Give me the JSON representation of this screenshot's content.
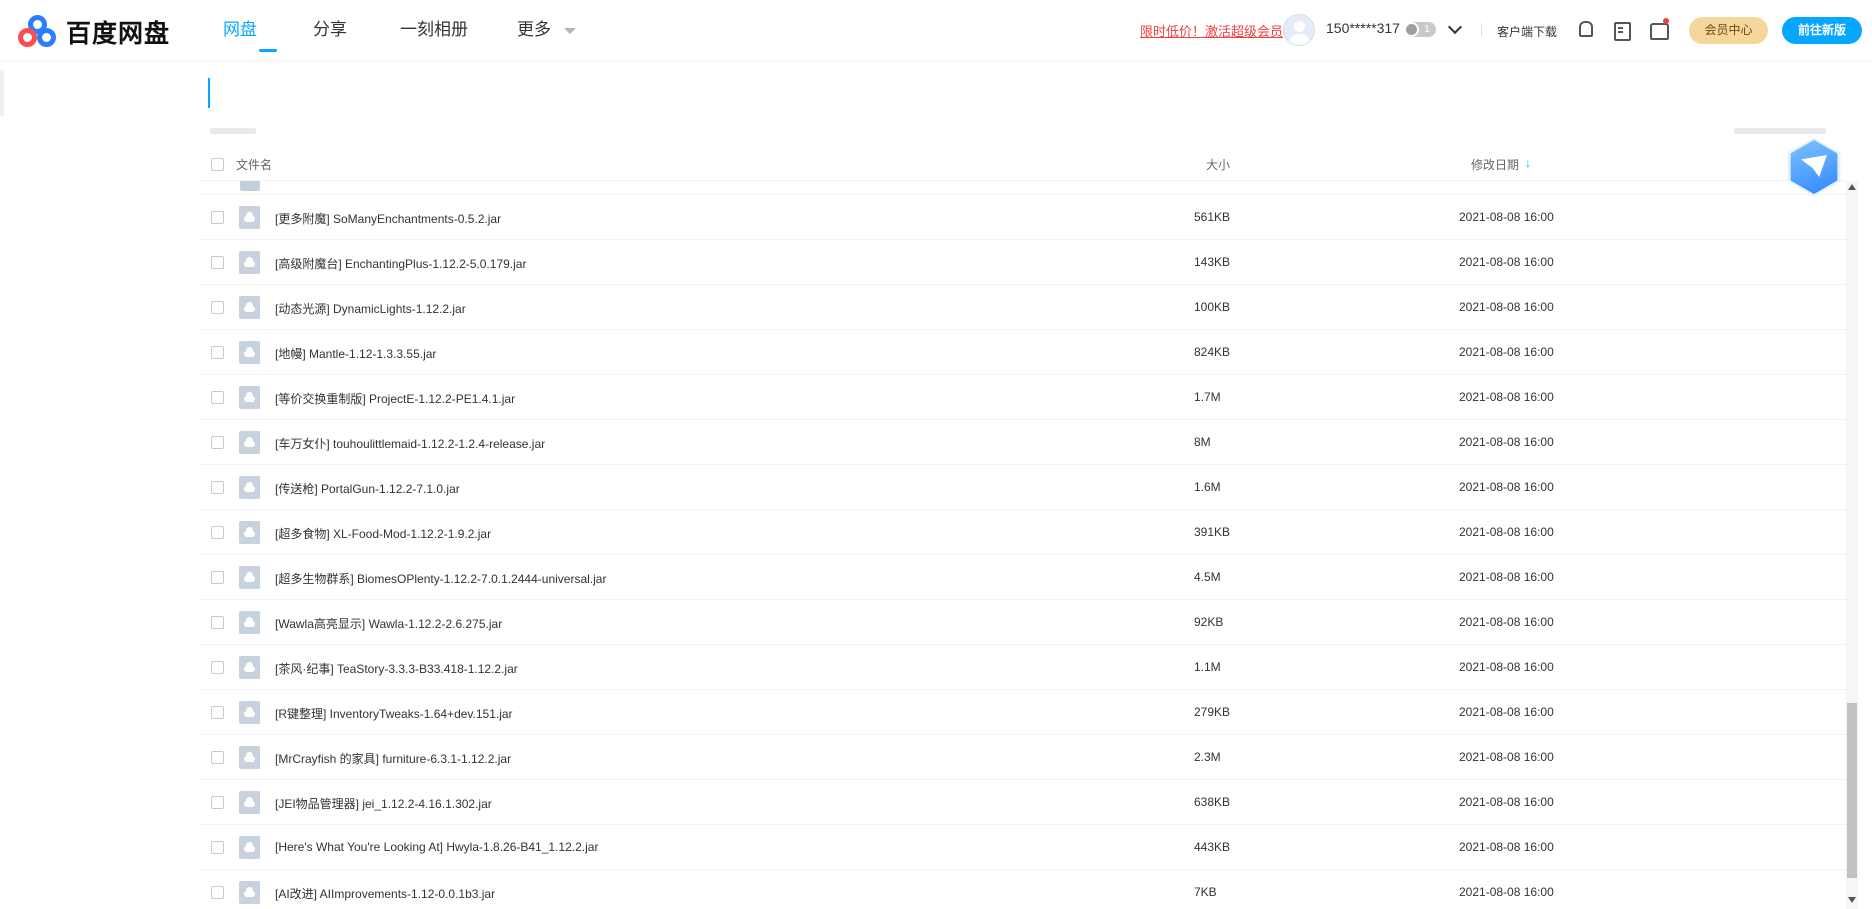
{
  "app": {
    "logo_text": "百度网盘"
  },
  "nav": {
    "items": [
      {
        "label": "网盘",
        "active": true
      },
      {
        "label": "分享",
        "active": false
      },
      {
        "label": "一刻相册",
        "active": false
      },
      {
        "label": "更多",
        "active": false
      }
    ]
  },
  "header": {
    "promo_text": "限时低价！激活超级会员",
    "username": "150*****317",
    "vip_level": "1",
    "client_download": "客户端下载",
    "member_center": "会员中心",
    "new_version": "前往新版",
    "icons": [
      "bell-icon",
      "clipboard-icon",
      "shirt-icon"
    ]
  },
  "file_list": {
    "columns": {
      "name": "文件名",
      "size": "大小",
      "date": "修改日期"
    },
    "sort": {
      "column": "date",
      "direction": "desc"
    },
    "rows": [
      {
        "name": "[更多附魔] SoManyEnchantments-0.5.2.jar",
        "size": "561KB",
        "date": "2021-08-08 16:00"
      },
      {
        "name": "[高级附魔台] EnchantingPlus-1.12.2-5.0.179.jar",
        "size": "143KB",
        "date": "2021-08-08 16:00"
      },
      {
        "name": "[动态光源] DynamicLights-1.12.2.jar",
        "size": "100KB",
        "date": "2021-08-08 16:00"
      },
      {
        "name": "[地幔] Mantle-1.12-1.3.3.55.jar",
        "size": "824KB",
        "date": "2021-08-08 16:00"
      },
      {
        "name": "[等价交换重制版] ProjectE-1.12.2-PE1.4.1.jar",
        "size": "1.7M",
        "date": "2021-08-08 16:00"
      },
      {
        "name": "[车万女仆] touhoulittlemaid-1.12.2-1.2.4-release.jar",
        "size": "8M",
        "date": "2021-08-08 16:00"
      },
      {
        "name": "[传送枪] PortalGun-1.12.2-7.1.0.jar",
        "size": "1.6M",
        "date": "2021-08-08 16:00"
      },
      {
        "name": "[超多食物] XL-Food-Mod-1.12.2-1.9.2.jar",
        "size": "391KB",
        "date": "2021-08-08 16:00"
      },
      {
        "name": "[超多生物群系] BiomesOPlenty-1.12.2-7.0.1.2444-universal.jar",
        "size": "4.5M",
        "date": "2021-08-08 16:00"
      },
      {
        "name": "[Wawla高亮显示] Wawla-1.12.2-2.6.275.jar",
        "size": "92KB",
        "date": "2021-08-08 16:00"
      },
      {
        "name": "[茶风·纪事] TeaStory-3.3.3-B33.418-1.12.2.jar",
        "size": "1.1M",
        "date": "2021-08-08 16:00"
      },
      {
        "name": "[R键整理] InventoryTweaks-1.64+dev.151.jar",
        "size": "279KB",
        "date": "2021-08-08 16:00"
      },
      {
        "name": "[MrCrayfish 的家具] furniture-6.3.1-1.12.2.jar",
        "size": "2.3M",
        "date": "2021-08-08 16:00"
      },
      {
        "name": "[JEI物品管理器] jei_1.12.2-4.16.1.302.jar",
        "size": "638KB",
        "date": "2021-08-08 16:00"
      },
      {
        "name": "[Here's What You're Looking At] Hwyla-1.8.26-B41_1.12.2.jar",
        "size": "443KB",
        "date": "2021-08-08 16:00"
      },
      {
        "name": "[AI改进] AIImprovements-1.12-0.0.1b3.jar",
        "size": "7KB",
        "date": "2021-08-08 16:00"
      }
    ]
  },
  "colors": {
    "accent": "#06a7ff",
    "promo": "#f33e3e",
    "member_gold": "#f5d79c"
  }
}
